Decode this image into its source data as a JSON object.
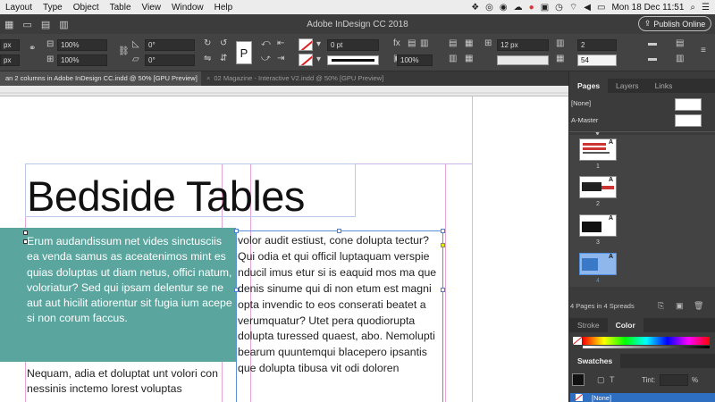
{
  "menubar": {
    "items": [
      "Layout",
      "Type",
      "Object",
      "Table",
      "View",
      "Window",
      "Help"
    ],
    "clock": "Mon 18 Dec  11:51"
  },
  "titlebar": {
    "title": "Adobe InDesign CC 2018",
    "publish_label": "Publish Online"
  },
  "controlbar": {
    "x_unit": "px",
    "y_unit": "px",
    "scale_x": "100%",
    "scale_y": "100%",
    "rotate": "0°",
    "shear": "0°",
    "stroke_weight": "0 pt",
    "opacity": "100%",
    "gutter": "12 px",
    "columns": "2",
    "frame_input": "54"
  },
  "tabs": {
    "active": "an 2 columns in Adobe InDesign CC.indd @ 50% [GPU Preview]",
    "inactive": "02 Magazine - Interactive V2.indd @ 50% [GPU Preview]",
    "close_glyph": "×"
  },
  "document": {
    "headline": "Bedside Tables",
    "teal_paragraph": "Erum audandissum net vides sinctusciis ea venda samus as aceatenimos mint es quias doluptas ut diam netus, offici natum, voloriatur? Sed qui ipsam delentur se ne aut aut hicilit atiorentur sit fugia ium acepe si non corum faccus.",
    "col1_paragraph": "Nequam, adia et doluptat unt volori con nessinis inctemo lorest voluptas",
    "col2_paragraph": "volor audit estiust, cone dolupta tectur? Qui odia et qui officil luptaquam verspie nducil imus etur si is eaquid mos ma que denis sinume qui di non etum est magni opta invendic to eos conserati beatet a verumquatur? Utet pera quodiorupta dolupta turessed quaest, abo. Nemolupti bearum quuntemqui blacepero ipsantis que dolupta tibusa vit odi doloren"
  },
  "panel": {
    "tabs": [
      "Pages",
      "Layers",
      "Links"
    ],
    "masters": [
      "[None]",
      "A-Master"
    ],
    "pages": [
      {
        "num": "1",
        "letter": "A"
      },
      {
        "num": "2",
        "letter": "A"
      },
      {
        "num": "3",
        "letter": "A"
      },
      {
        "num": "4",
        "letter": "A"
      }
    ],
    "status": "4 Pages in 4 Spreads",
    "color_tabs": [
      "Stroke",
      "Color"
    ],
    "swatches_title": "Swatches",
    "tint_label": "Tint:",
    "tint_unit": "%",
    "swatch_none": "[None]"
  }
}
